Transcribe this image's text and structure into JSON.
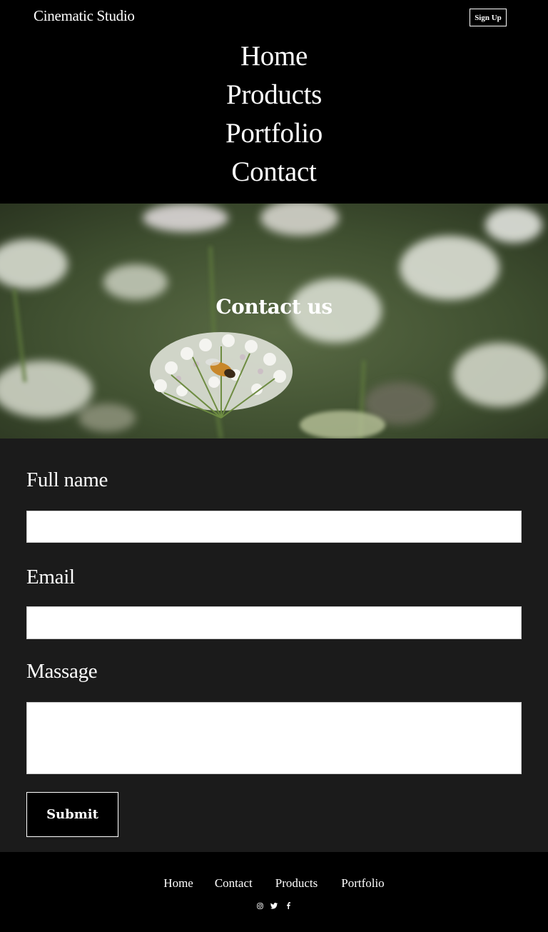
{
  "header": {
    "brand": "Cinematic Studio",
    "signup_label": "Sign Up",
    "nav": [
      "Home",
      "Products",
      "Portfolio",
      "Contact"
    ]
  },
  "hero": {
    "title": "Contact us"
  },
  "form": {
    "fullname_label": "Full name",
    "fullname_value": "",
    "email_label": "Email",
    "email_value": "",
    "message_label": "Massage",
    "message_value": "",
    "submit_label": "Submit"
  },
  "footer": {
    "links": [
      "Home",
      "Contact",
      "Products",
      "Portfolio"
    ],
    "social_icons": [
      "instagram-icon",
      "twitter-icon",
      "facebook-icon"
    ]
  },
  "colors": {
    "header_bg": "#000000",
    "form_bg": "#1b1b1b",
    "text": "#ffffff"
  }
}
